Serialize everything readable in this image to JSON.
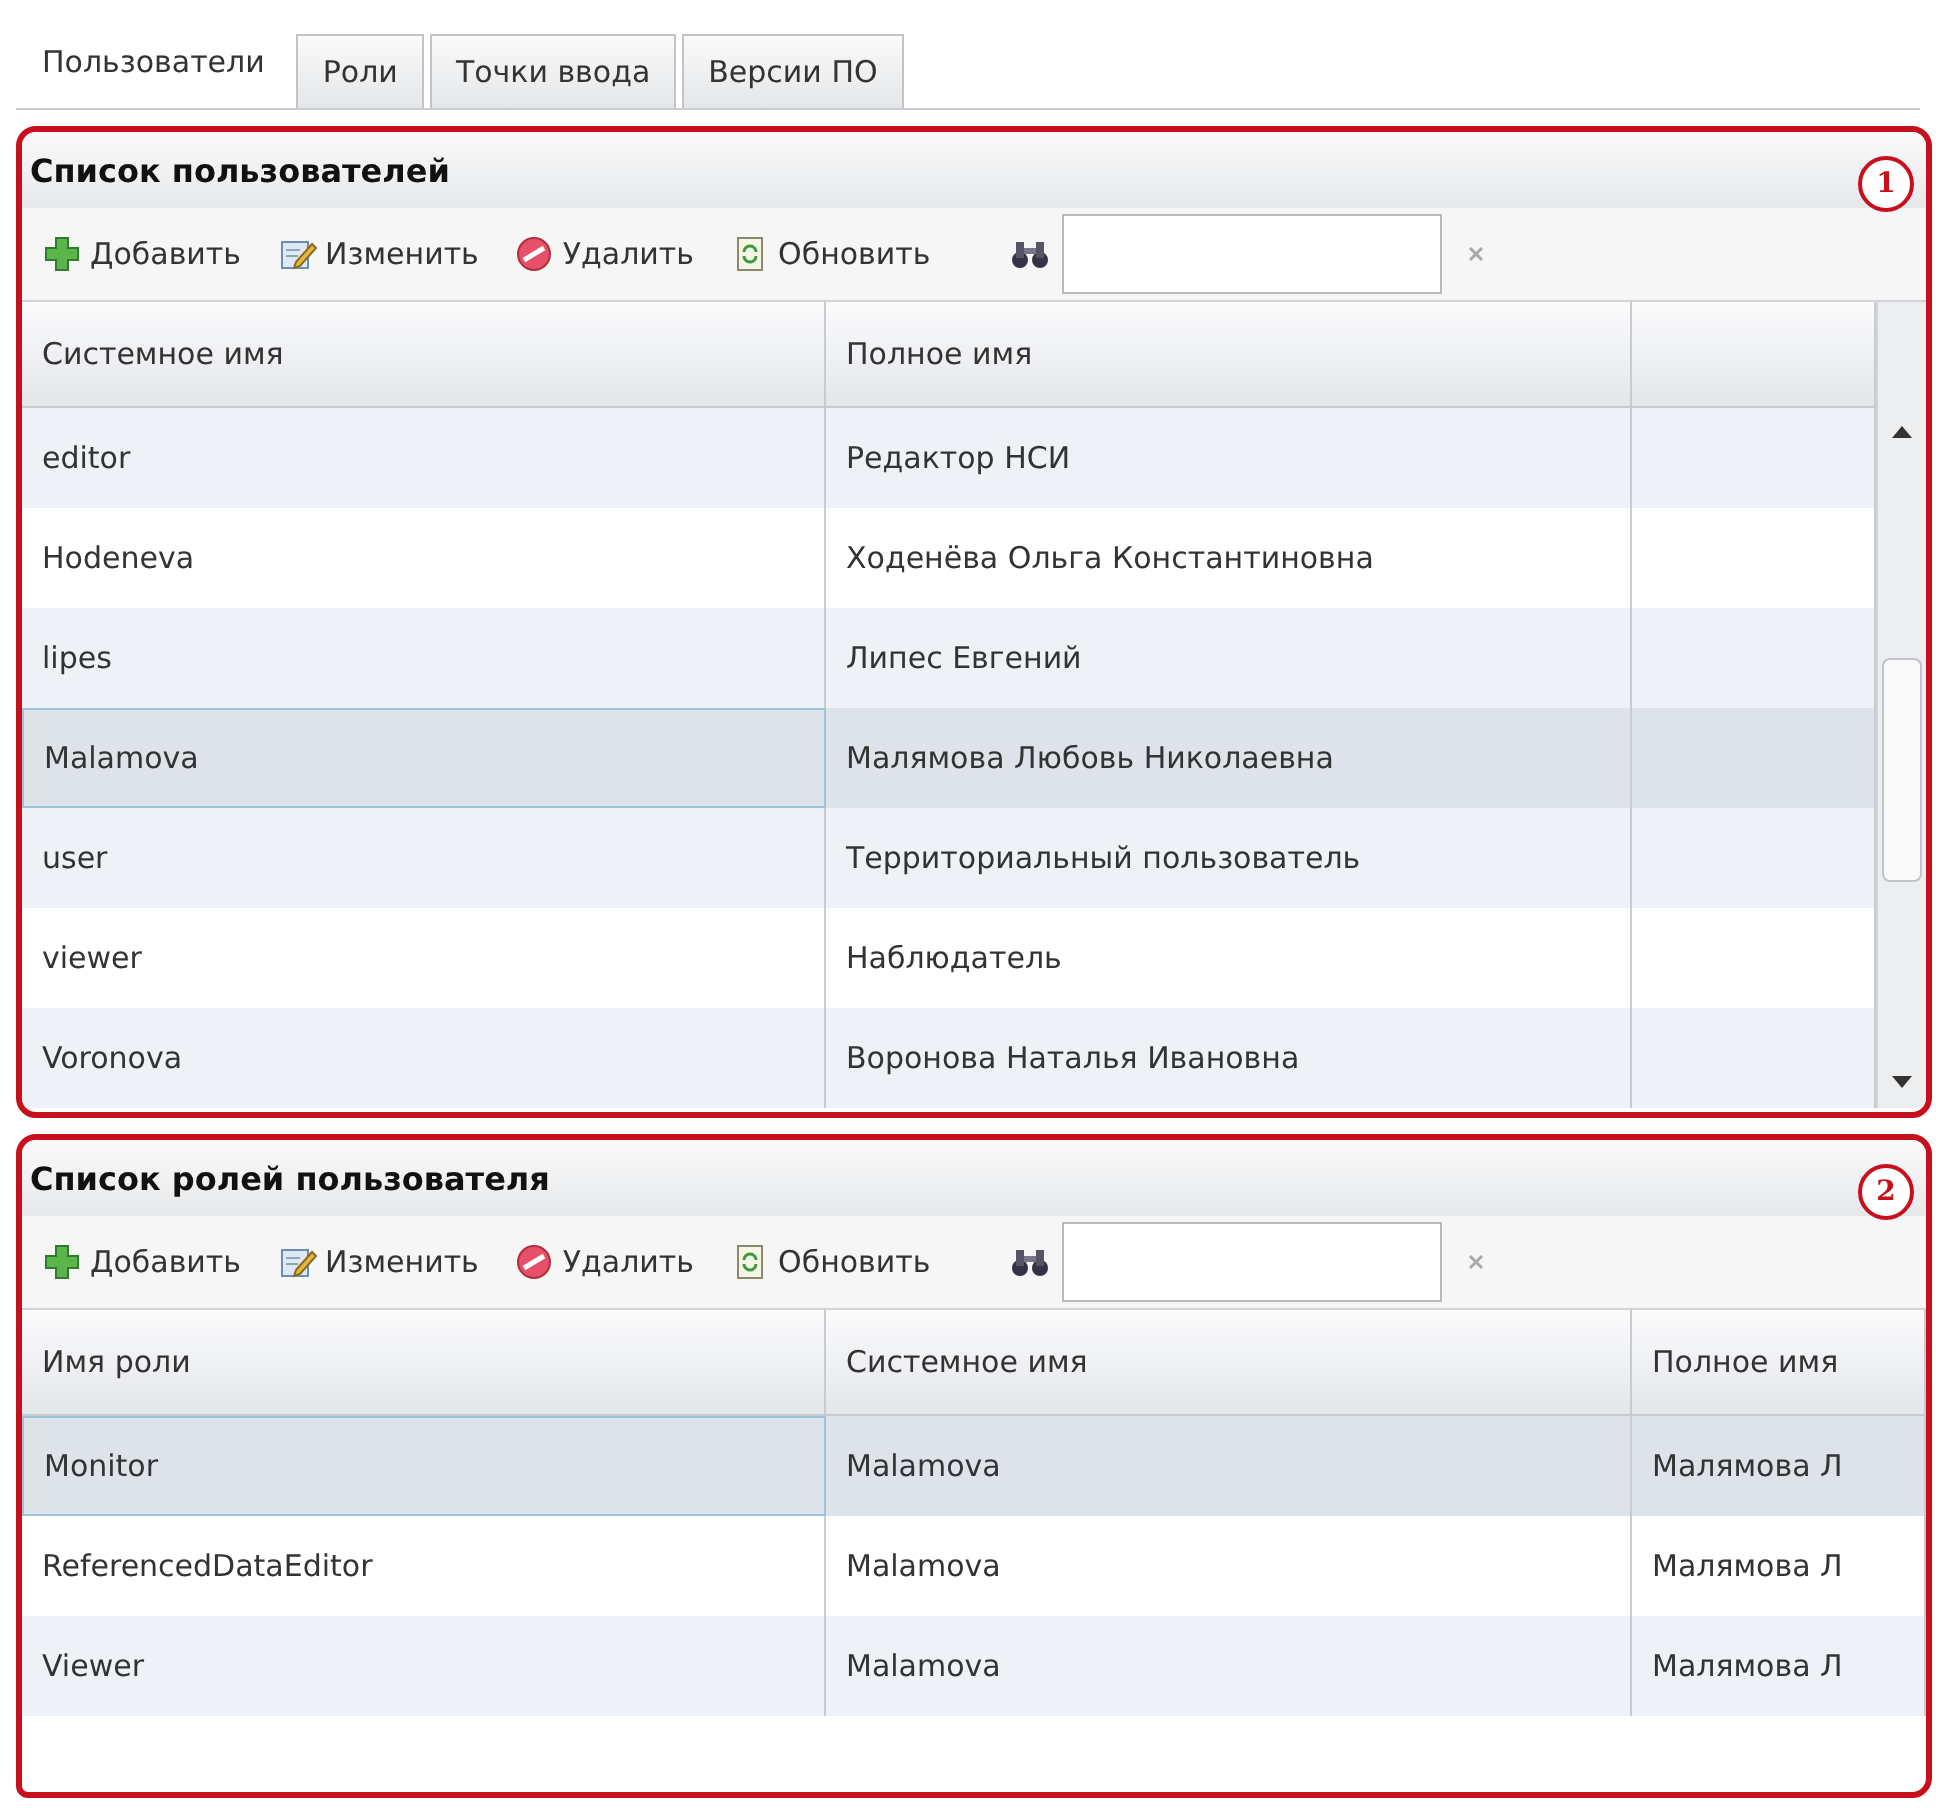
{
  "tabs": [
    {
      "label": "Пользователи",
      "selected": true
    },
    {
      "label": "Роли",
      "selected": false
    },
    {
      "label": "Точки ввода",
      "selected": false
    },
    {
      "label": "Версии ПО",
      "selected": false
    }
  ],
  "panels": [
    {
      "title": "Список пользователей",
      "marker": "1",
      "toolbar": [
        "Добавить",
        "Изменить",
        "Удалить",
        "Обновить"
      ],
      "columns": [
        "Системное имя",
        "Полное имя"
      ],
      "scrollbar": true,
      "rows": [
        {
          "cells": [
            "editor",
            "Редактор НСИ"
          ],
          "selected": false
        },
        {
          "cells": [
            "Hodeneva",
            "Ходенёва Ольга Константиновна"
          ],
          "selected": false
        },
        {
          "cells": [
            "lipes",
            "Липес Евгений"
          ],
          "selected": false
        },
        {
          "cells": [
            "Malamova",
            "Малямова Любовь Николаевна"
          ],
          "selected": true
        },
        {
          "cells": [
            "user",
            "Территориальный пользователь"
          ],
          "selected": false
        },
        {
          "cells": [
            "viewer",
            "Наблюдатель"
          ],
          "selected": false
        },
        {
          "cells": [
            "Voronova",
            "Воронова Наталья Ивановна"
          ],
          "selected": false
        }
      ]
    },
    {
      "title": "Список ролей пользователя",
      "marker": "2",
      "toolbar": [
        "Добавить",
        "Изменить",
        "Удалить",
        "Обновить"
      ],
      "columns": [
        "Имя роли",
        "Системное имя",
        "Полное имя"
      ],
      "scrollbar": false,
      "rows": [
        {
          "cells": [
            "Monitor",
            "Malamova",
            "Малямова Л"
          ],
          "selected": true
        },
        {
          "cells": [
            "ReferencedDataEditor",
            "Malamova",
            "Малямова Л"
          ],
          "selected": false
        },
        {
          "cells": [
            "Viewer",
            "Malamova",
            "Малямова Л"
          ],
          "selected": false
        }
      ]
    }
  ]
}
